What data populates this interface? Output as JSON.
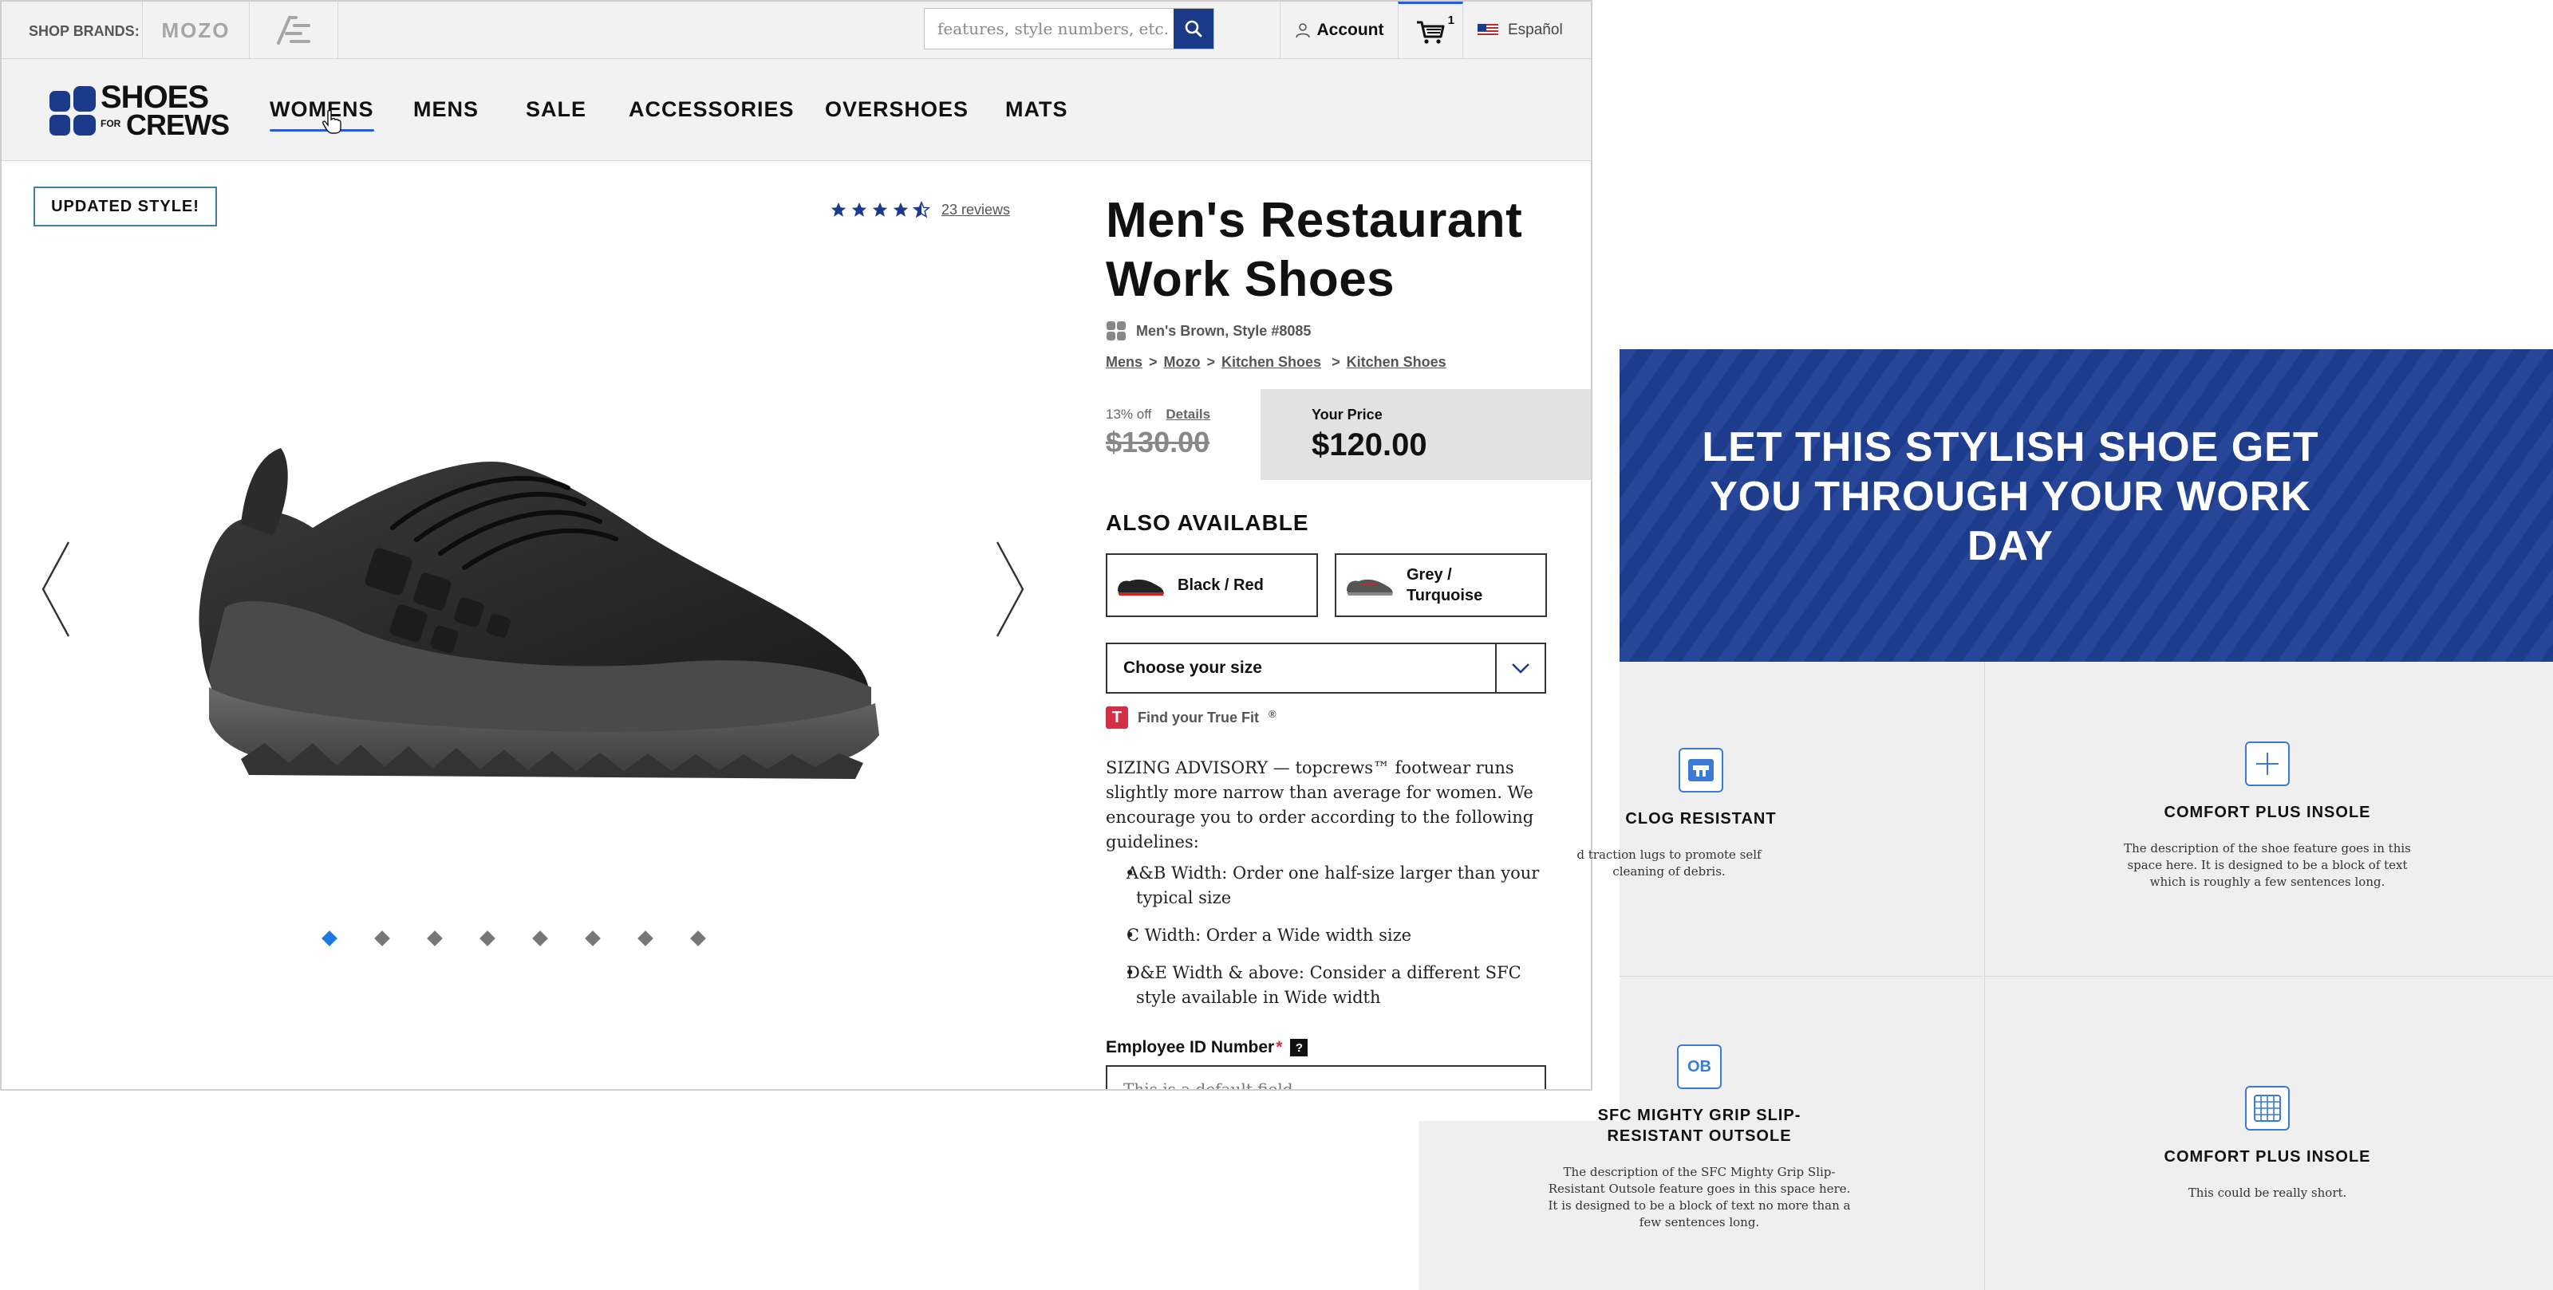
{
  "topbar": {
    "shop_brands_label": "SHOP BRANDS:",
    "brand_mozo": "MOZO",
    "search_placeholder": "features, style numbers, etc.",
    "account_label": "Account",
    "cart_count": "1",
    "language_label": "Español"
  },
  "nav": {
    "logo_line1": "SHOES",
    "logo_for": "FOR",
    "logo_line2": "CREWS",
    "items": [
      "WOMENS",
      "MENS",
      "SALE",
      "ACCESSORIES",
      "OVERSHOES",
      "MATS"
    ]
  },
  "gallery": {
    "badge": "UPDATED STYLE!",
    "rating": 4.5,
    "reviews_link": "23 reviews",
    "image_count": 8,
    "active_image": 1
  },
  "product": {
    "title": "Men's Restaurant Work Shoes",
    "style_line": "Men's Brown, Style #8085",
    "breadcrumb": [
      "Mens",
      "Mozo",
      "Kitchen Shoes",
      "Kitchen Shoes"
    ],
    "discount": "13% off",
    "details_link": "Details",
    "old_price": "$130.00",
    "your_price_label": "Your Price",
    "your_price": "$120.00",
    "also_available_label": "ALSO AVAILABLE",
    "variants": [
      {
        "line1": "Black / Red",
        "line2": ""
      },
      {
        "line1": "Grey /",
        "line2": "Turquoise"
      }
    ],
    "size_select_label": "Choose your size",
    "truefit_label": "Find your True Fit",
    "advisory_intro": "SIZING ADVISORY — topcrews™ footwear runs slightly more narrow than average for women. We encourage you to order according to the following guidelines:",
    "advisory_items": [
      "A&B Width: Order one half-size larger than your typical size",
      "C Width: Order a Wide width size",
      "D&E Width & above: Consider a different SFC style available in Wide width"
    ],
    "employee_label": "Employee ID Number",
    "employee_required": "*",
    "employee_placeholder": "This is a default field"
  },
  "features": {
    "hero_title": "LET THIS STYLISH SHOE GET YOU THROUGH YOUR WORK DAY",
    "items": [
      {
        "icon": "clog-resistant-icon",
        "title": "CLOG RESISTANT",
        "desc": "d traction lugs to promote self cleaning of debris."
      },
      {
        "icon": "comfort-insole-icon",
        "title": "COMFORT PLUS INSOLE",
        "desc": "The description of the shoe feature goes in this space here. It is designed to be a block of text which is roughly a few sentences long."
      },
      {
        "icon": "outsole-icon",
        "title": "SFC MIGHTY GRIP SLIP-RESISTANT OUTSOLE",
        "icon_text": "OB",
        "desc": "The description of the SFC Mighty Grip Slip-Resistant Outsole feature goes in this space here. It is designed to be a block of text no more than a few sentences long."
      },
      {
        "icon": "insole-grid-icon",
        "title": "COMFORT PLUS INSOLE",
        "desc": "This could be really short."
      }
    ]
  },
  "colors": {
    "brand_blue": "#1b3a8a",
    "accent_blue": "#2a5bd7",
    "hero_blue": "#1f3f94",
    "required_red": "#d32f45"
  }
}
